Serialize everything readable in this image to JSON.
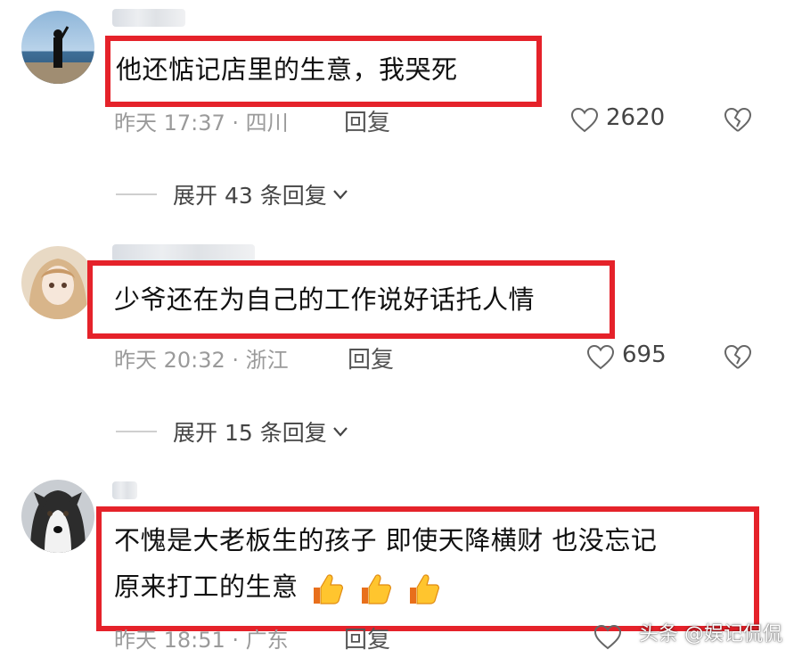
{
  "comments": [
    {
      "text": "他还惦记店里的生意，我哭死",
      "time": "昨天 17:37 · 四川",
      "reply_label": "回复",
      "likes": "2620",
      "expand_label": "展开 43 条回复",
      "avatar": "man-by-sea"
    },
    {
      "text": "少爷还在为自己的工作说好话托人情",
      "time": "昨天 20:32 · 浙江",
      "reply_label": "回复",
      "likes": "695",
      "expand_label": "展开 15 条回复",
      "avatar": "anime-girl"
    },
    {
      "text_line1": "不愧是大老板生的孩子 即使天降横财 也没忘记",
      "text_line2": "原来打工的生意",
      "emojis": [
        "thumbs-up",
        "thumbs-up",
        "thumbs-up"
      ],
      "time": "昨天 18:51 · 广东",
      "reply_label": "回复",
      "avatar": "husky-dog"
    }
  ],
  "watermark": "头条 @娱记侃侃",
  "colors": {
    "highlight": "#e5222a",
    "meta": "#9a9a9a",
    "text": "#111111"
  },
  "icons": {
    "like": "heart-outline-icon",
    "dislike": "broken-heart-icon",
    "expand": "chevron-down-icon"
  }
}
